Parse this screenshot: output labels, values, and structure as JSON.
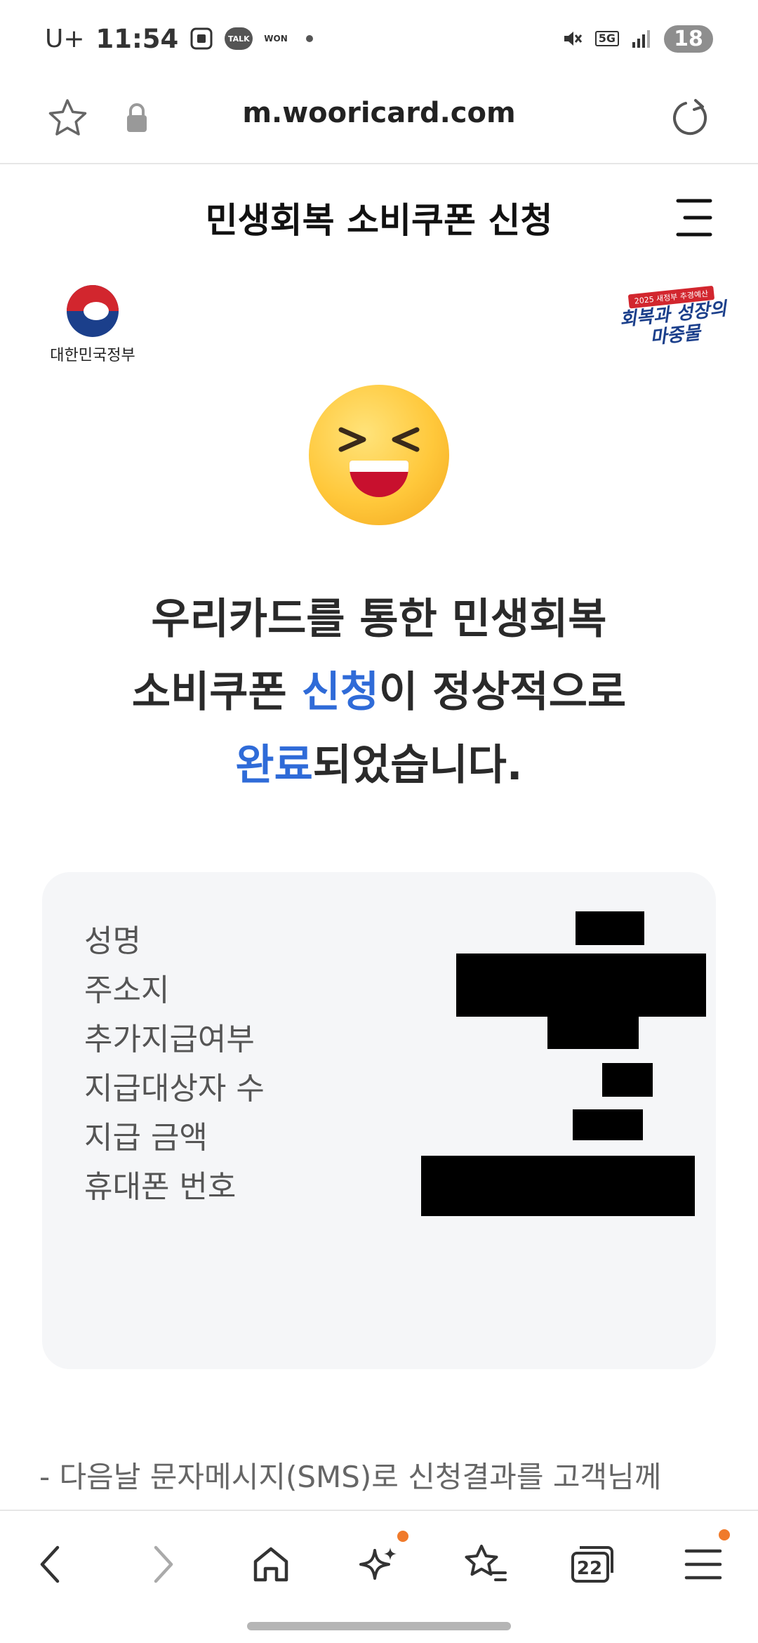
{
  "status_bar": {
    "carrier": "U+",
    "time": "11:54",
    "talk_label": "TALK",
    "won_label": "WON",
    "network": "5G",
    "battery": "18",
    "icons": [
      "screenshot-icon",
      "talk-icon",
      "won-icon",
      "mute-icon",
      "signal-icon"
    ]
  },
  "browser": {
    "url": "m.wooricard.com",
    "icons": [
      "star-icon",
      "lock-icon",
      "reload-icon"
    ]
  },
  "header": {
    "title": "민생회복 소비쿠폰 신청"
  },
  "logos": {
    "government": "대한민국정부",
    "campaign_tag": "2025 새정부 추경예산",
    "campaign_title_line1": "회복과 성장의",
    "campaign_title_line2": "마중물"
  },
  "message": {
    "line1": "우리카드를 통한 민생회복",
    "line2_prefix": "소비쿠폰 ",
    "line2_accent": "신청",
    "line2_suffix": "이 정상적으로",
    "line3_accent": "완료",
    "line3_suffix": "되었습니다."
  },
  "info": {
    "rows": [
      {
        "label": "성명",
        "value": "redacted"
      },
      {
        "label": "주소지",
        "value": "redacted"
      },
      {
        "label": "추가지급여부",
        "value": "redacted"
      },
      {
        "label": "지급대상자 수",
        "value": "redacted"
      },
      {
        "label": "지급 금액",
        "value": "redacted"
      },
      {
        "label": "휴대폰 번호",
        "value": "redacted"
      }
    ]
  },
  "notice": {
    "text": "-  다음날 문자메시지(SMS)로 신청결과를 고객님께"
  },
  "bottom_nav": {
    "tab_count": "22",
    "items": [
      "back-icon",
      "forward-icon",
      "home-icon",
      "ai-sparkle-icon",
      "bookmarks-icon",
      "tabs-icon",
      "menu-icon"
    ]
  },
  "colors": {
    "accent": "#2f6bd8",
    "badge": "#f07a2b",
    "card_bg": "#f5f6f8"
  }
}
